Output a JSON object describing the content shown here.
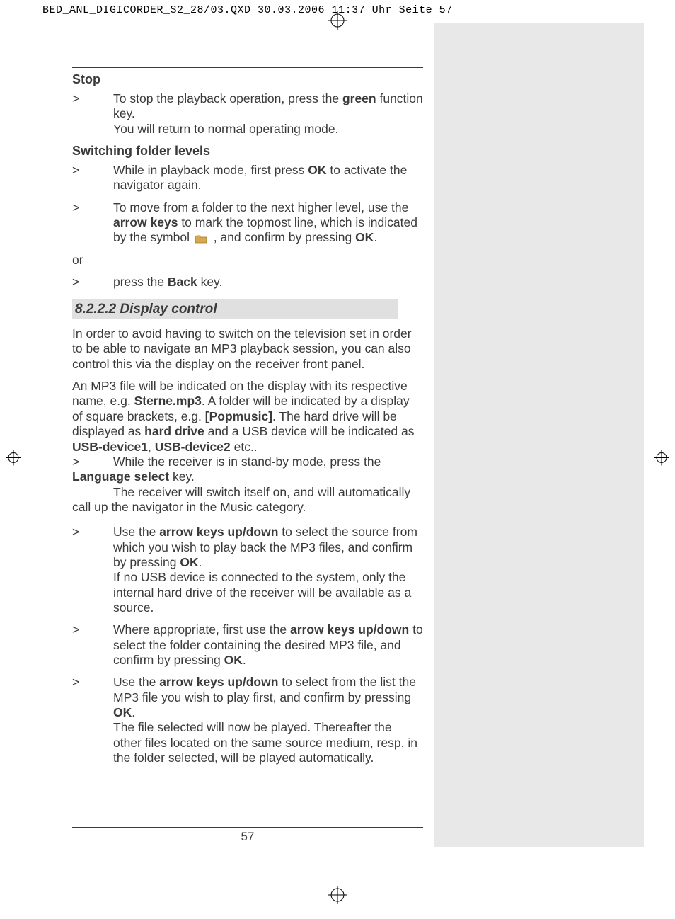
{
  "slug": "BED_ANL_DIGICORDER_S2_28/03.QXD  30.03.2006  11:37 Uhr  Seite 57",
  "page_number": "57",
  "sections": {
    "stop": {
      "title": "Stop",
      "b1_pre": "To stop the playback operation, press the ",
      "b1_bold": "green",
      "b1_post": " function key.",
      "b1_line2": "You will return to normal operating mode."
    },
    "folders": {
      "title": "Switching folder levels",
      "b1_pre": "While in playback mode, first press ",
      "b1_bold": "OK",
      "b1_post": " to activate the navigator again.",
      "b2_pre": "To move from a folder to the next higher level, use the ",
      "b2_bold1": "arrow keys",
      "b2_mid": " to mark the topmost line, which is indicated by the symbol ",
      "b2_mid2": " , and confirm by pressing ",
      "b2_bold2": "OK",
      "b2_post": ".",
      "or": "or",
      "b3_pre": "press the ",
      "b3_bold": "Back",
      "b3_post": " key."
    },
    "display": {
      "title": "8.2.2.2 Display control",
      "p1": "In order to avoid having to switch on the television set in order to be able to navigate an MP3 playback session, you can also control this via the display on the receiver front panel.",
      "p2_a": "An MP3 file will be indicated on the display with its respective name, e.g. ",
      "p2_bold1": "Sterne.mp3",
      "p2_b": ". A folder will be indicated by a display of square brackets, e.g. ",
      "p2_bold2": "[Popmusic]",
      "p2_c": ". The hard drive will be displayed as ",
      "p2_bold3": "hard drive",
      "p2_d": " and a USB device will be indicated as ",
      "p2_bold4": "USB-device1",
      "p2_e": ", ",
      "p2_bold5": "USB-device2",
      "p2_f": " etc..",
      "b1_pre": "While the receiver is in stand-by mode, press the ",
      "b1_bold": "Language select",
      "b1_post": " key.",
      "b1_line2": "The receiver will switch itself on, and will automatically call up the navigator in the Music category.",
      "b2_pre": "Use the ",
      "b2_bold1": "arrow keys up/down",
      "b2_mid": " to select the source from which you wish to play back the MP3 files, and confirm by pressing ",
      "b2_bold2": "OK",
      "b2_post": ".",
      "b2_line2": "If no USB device is connected to the system, only the internal hard drive of the receiver will be available as a source.",
      "b3_pre": "Where appropriate, first use the ",
      "b3_bold1": "arrow keys up/down",
      "b3_mid": " to select the folder containing the desired MP3 file, and confirm by pressing ",
      "b3_bold2": "OK",
      "b3_post": ".",
      "b4_pre": "Use the ",
      "b4_bold1": "arrow keys up/down",
      "b4_mid": " to select from the list the MP3 file you wish to play first, and confirm by pressing ",
      "b4_bold2": "OK",
      "b4_post": ".",
      "b4_line2": "The file selected will now be played. Thereafter the other files located on the same source medium, resp. in the folder selected, will be played automatically."
    }
  },
  "marker": ">"
}
